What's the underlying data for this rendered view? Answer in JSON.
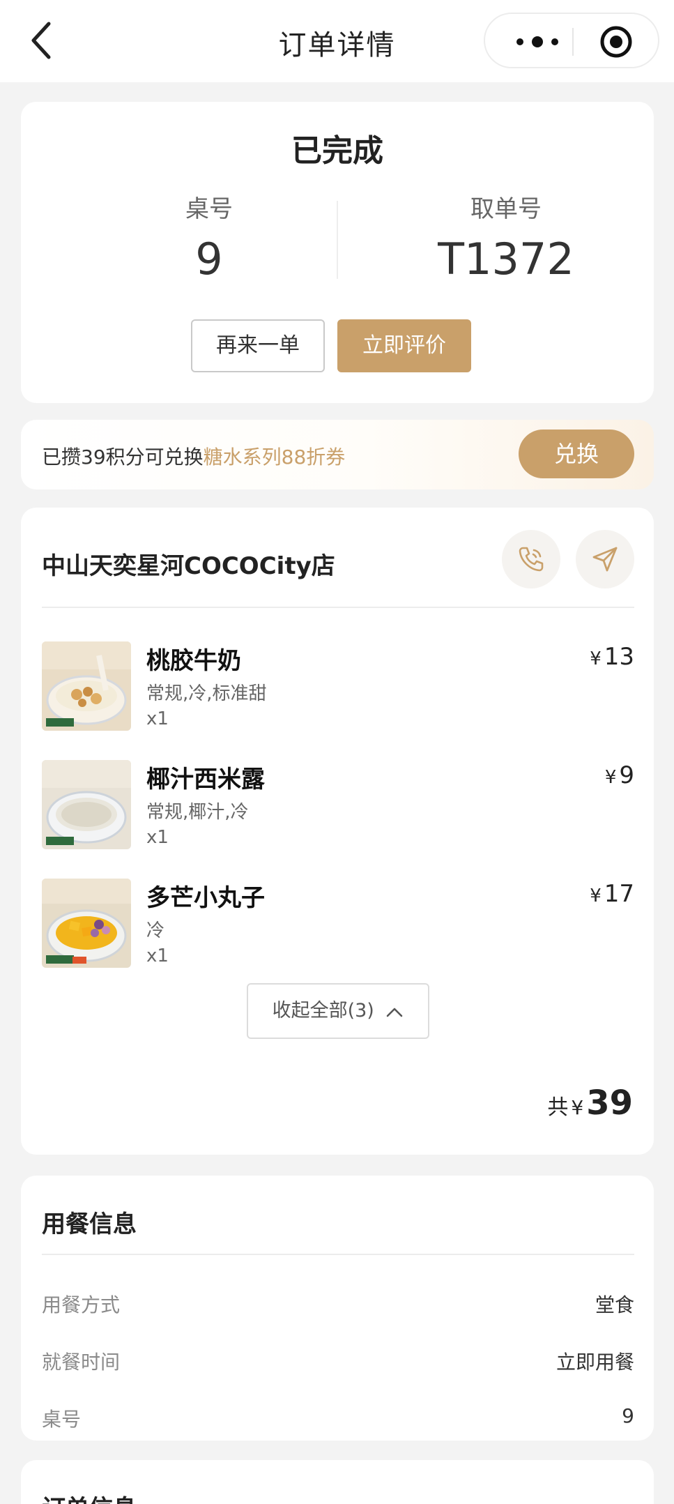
{
  "navbar": {
    "title": "订单详情"
  },
  "status": {
    "title": "已完成",
    "table_label": "桌号",
    "table_value": "9",
    "pickup_label": "取单号",
    "pickup_value": "T1372",
    "reorder_label": "再来一单",
    "review_label": "立即评价"
  },
  "points": {
    "text_prefix": "已攒39积分可兑换",
    "text_highlight": "糖水系列88折券",
    "exchange_label": "兑换"
  },
  "order": {
    "store_name": "中山天奕星河COCOCity店",
    "currency": "¥",
    "items": [
      {
        "name": "桃胶牛奶",
        "spec": "常规,冷,标准甜",
        "qty": "x1",
        "price": "13"
      },
      {
        "name": "椰汁西米露",
        "spec": "常规,椰汁,冷",
        "qty": "x1",
        "price": "9"
      },
      {
        "name": "多芒小丸子",
        "spec": "冷",
        "qty": "x1",
        "price": "17"
      }
    ],
    "collapse_label": "收起全部(3)",
    "total_label": "共",
    "total_amount": "39"
  },
  "dining": {
    "title": "用餐信息",
    "rows": [
      {
        "key": "用餐方式",
        "value": "堂食"
      },
      {
        "key": "就餐时间",
        "value": "立即用餐"
      },
      {
        "key": "桌号",
        "value": "9"
      }
    ]
  },
  "order_info": {
    "title": "订单信息"
  },
  "colors": {
    "accent": "#c9a06a",
    "background": "#f3f3f3"
  }
}
